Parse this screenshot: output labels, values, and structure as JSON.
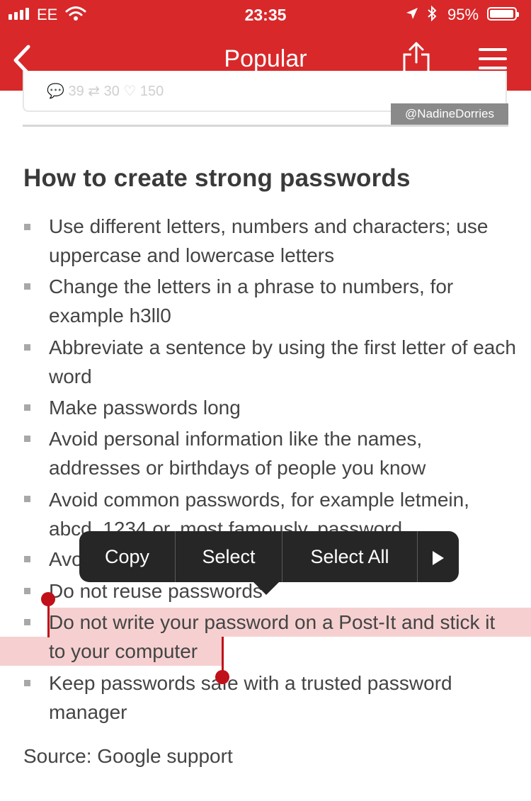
{
  "status_bar": {
    "carrier": "EE",
    "time": "23:35",
    "battery": "95%",
    "icons": [
      "signal-icon",
      "wifi-icon",
      "location-icon",
      "bluetooth-icon",
      "battery-icon"
    ]
  },
  "nav": {
    "title": "Popular",
    "back_icon": "chevron-left-icon",
    "share_icon": "share-icon",
    "menu_icon": "hamburger-menu-icon",
    "background": "#d8282a"
  },
  "card": {
    "actions": "💬 39    ⇄ 30    ♡ 150",
    "handle": "@NadineDorries"
  },
  "article": {
    "heading": "How to create strong passwords",
    "tips": [
      "Use different letters, numbers and characters; use uppercase and lowercase letters",
      "Change the letters in a phrase to numbers, for example h3ll0",
      "Abbreviate a sentence by using the first letter of each word",
      "Make passwords long",
      "Avoid personal information like the names, addresses or birthdays of people you know",
      "Avoid common passwords, for example letmein, abcd, 1234 or, most famously, password",
      "Avoid",
      "Do not reuse passwords",
      "Do not write your password on a Post-It and stick it to your computer",
      "Keep passwords safe with a trusted password manager"
    ],
    "source": "Source: Google support"
  },
  "edit_menu": {
    "copy": "Copy",
    "select": "Select",
    "select_all": "Select All",
    "more_icon": "triangle-right-icon"
  },
  "colors": {
    "accent": "#d8282a",
    "selection": "#f4c9ca",
    "menu_bg": "#262626"
  }
}
